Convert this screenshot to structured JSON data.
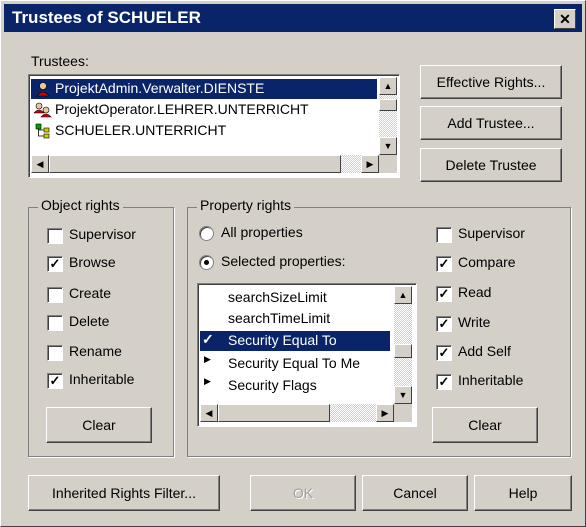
{
  "window": {
    "title": "Trustees of SCHUELER",
    "close_glyph": "✕"
  },
  "trustees": {
    "label": "Trustees:",
    "items": [
      {
        "label": "ProjektAdmin.Verwalter.DIENSTE",
        "icon": "user-icon",
        "selected": true
      },
      {
        "label": "ProjektOperator.LEHRER.UNTERRICHT",
        "icon": "group-icon",
        "selected": false
      },
      {
        "label": "SCHUELER.UNTERRICHT",
        "icon": "container-icon",
        "selected": false
      }
    ]
  },
  "buttons": {
    "effective_rights": "Effective Rights...",
    "add_trustee": "Add Trustee...",
    "delete_trustee": "Delete Trustee",
    "clear_object": "Clear",
    "clear_property": "Clear",
    "inherited_filter": "Inherited Rights Filter...",
    "ok": "OK",
    "cancel": "Cancel",
    "help": "Help"
  },
  "object_rights": {
    "label": "Object rights",
    "items": [
      {
        "label": "Supervisor",
        "checked": false
      },
      {
        "label": "Browse",
        "checked": true
      },
      {
        "label": "Create",
        "checked": false
      },
      {
        "label": "Delete",
        "checked": false
      },
      {
        "label": "Rename",
        "checked": false
      },
      {
        "label": "Inheritable",
        "checked": true
      }
    ]
  },
  "property_rights": {
    "label": "Property rights",
    "all_properties": "All properties",
    "selected_properties": "Selected properties:",
    "selected_mode": "selected",
    "properties": [
      {
        "label": "searchSizeLimit",
        "marker": "",
        "selected": false
      },
      {
        "label": "searchTimeLimit",
        "marker": "",
        "selected": false
      },
      {
        "label": "Security Equal To",
        "marker": "check",
        "selected": true
      },
      {
        "label": "Security Equal To Me",
        "marker": "arrow",
        "selected": false
      },
      {
        "label": "Security Flags",
        "marker": "arrow",
        "selected": false
      }
    ],
    "rights": [
      {
        "label": "Supervisor",
        "checked": false
      },
      {
        "label": "Compare",
        "checked": true
      },
      {
        "label": "Read",
        "checked": true
      },
      {
        "label": "Write",
        "checked": true
      },
      {
        "label": "Add Self",
        "checked": true
      },
      {
        "label": "Inheritable",
        "checked": true
      }
    ]
  },
  "colors": {
    "face": "#d4d0c8",
    "title_bar": "#0a246a",
    "selection": "#0a246a"
  }
}
